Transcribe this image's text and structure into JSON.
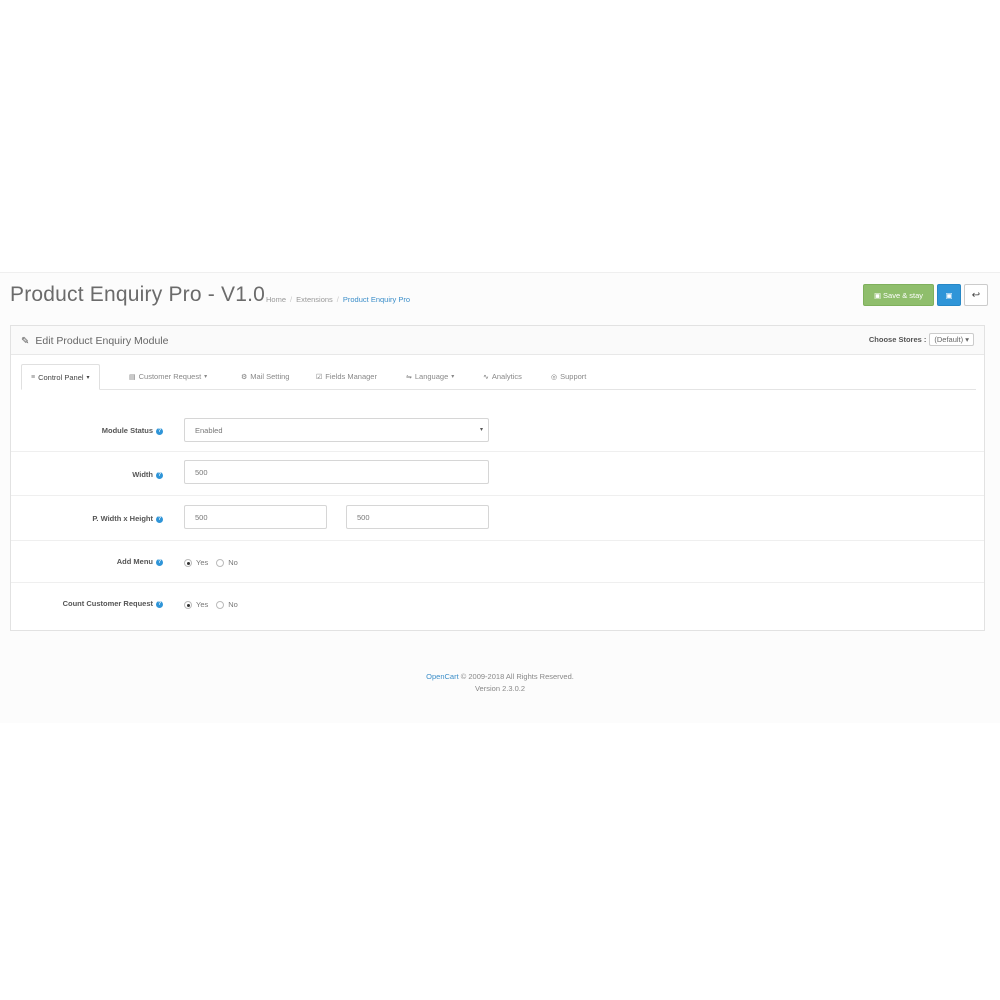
{
  "header": {
    "title": "Product Enquiry Pro - V1.0",
    "breadcrumb": [
      "Home",
      "Extensions",
      "Product Enquiry Pro"
    ],
    "buttons": {
      "save_stay": "Save & stay",
      "save_icon": "floppy-icon",
      "back_icon": "reply-icon"
    }
  },
  "panel": {
    "title": "Edit Product Enquiry Module",
    "store_label": "Choose Stores :",
    "store_value": "(Default)"
  },
  "tabs": [
    {
      "label": "Control Panel",
      "icon": "sliders-icon",
      "dropdown": true,
      "active": true
    },
    {
      "label": "Customer Request",
      "icon": "list-icon",
      "dropdown": true
    },
    {
      "label": "Mail Setting",
      "icon": "gear-icon"
    },
    {
      "label": "Fields Manager",
      "icon": "checkbox-icon"
    },
    {
      "label": "Language",
      "icon": "translate-icon",
      "dropdown": true
    },
    {
      "label": "Analytics",
      "icon": "line-chart-icon"
    },
    {
      "label": "Support",
      "icon": "lifebuoy-icon"
    }
  ],
  "form": {
    "module_status": {
      "label": "Module Status",
      "value": "Enabled"
    },
    "width": {
      "label": "Width",
      "value": "500"
    },
    "popup_size": {
      "label": "P. Width x Height",
      "width": "500",
      "height": "500"
    },
    "add_menu": {
      "label": "Add Menu",
      "options": [
        "Yes",
        "No"
      ],
      "selected": "Yes"
    },
    "count_request": {
      "label": "Count Customer Request",
      "options": [
        "Yes",
        "No"
      ],
      "selected": "Yes"
    }
  },
  "footer": {
    "brand": "OpenCart",
    "copyright": "© 2009-2018 All Rights Reserved.",
    "version": "Version 2.3.0.2"
  },
  "colors": {
    "accent": "#2f95d8",
    "success": "#8fbe6c"
  }
}
